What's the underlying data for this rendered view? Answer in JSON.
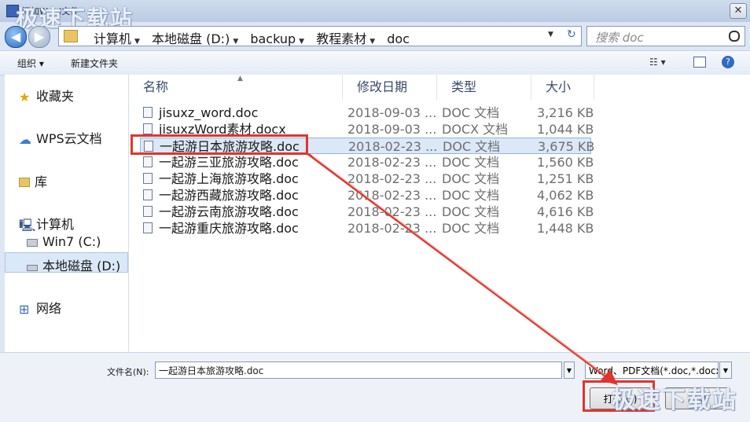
{
  "window": {
    "title": "添加Word文件",
    "close_glyph": "✕",
    "watermark": "极速下载站"
  },
  "address": {
    "crumbs": [
      "计算机",
      "本地磁盘 (D:)",
      "backup",
      "教程素材",
      "doc"
    ],
    "search_placeholder": "搜索 doc"
  },
  "toolbar": {
    "organize": "组织 ▾",
    "new_folder": "新建文件夹",
    "help": "?"
  },
  "sidebar": {
    "items": [
      {
        "label": "收藏夹",
        "icon": "star-icon"
      },
      {
        "label": "WPS云文档",
        "icon": "cloud-icon"
      },
      {
        "label": "库",
        "icon": "library-icon"
      },
      {
        "label": "计算机",
        "icon": "computer-icon"
      },
      {
        "label": "Win7 (C:)",
        "icon": "drive-icon"
      },
      {
        "label": "本地磁盘 (D:)",
        "icon": "drive-icon"
      },
      {
        "label": "网络",
        "icon": "network-icon"
      }
    ]
  },
  "columns": {
    "name": "名称",
    "date": "修改日期",
    "type": "类型",
    "size": "大小"
  },
  "files": [
    {
      "name": "jisuxz_word.doc",
      "date": "2018-09-03 ...",
      "type": "DOC 文档",
      "size": "3,216 KB"
    },
    {
      "name": "jisuxzWord素材.docx",
      "date": "2018-09-03 ...",
      "type": "DOCX 文档",
      "size": "1,044 KB"
    },
    {
      "name": "一起游日本旅游攻略.doc",
      "date": "2018-02-23 ...",
      "type": "DOC 文档",
      "size": "3,675 KB"
    },
    {
      "name": "一起游三亚旅游攻略.doc",
      "date": "2018-02-23 ...",
      "type": "DOC 文档",
      "size": "1,560 KB"
    },
    {
      "name": "一起游上海旅游攻略.doc",
      "date": "2018-02-23 ...",
      "type": "DOC 文档",
      "size": "1,251 KB"
    },
    {
      "name": "一起游西藏旅游攻略.doc",
      "date": "2018-02-23 ...",
      "type": "DOC 文档",
      "size": "4,062 KB"
    },
    {
      "name": "一起游云南旅游攻略.doc",
      "date": "2018-02-23 ...",
      "type": "DOC 文档",
      "size": "4,616 KB"
    },
    {
      "name": "一起游重庆旅游攻略.doc",
      "date": "2018-02-23 ...",
      "type": "DOC 文档",
      "size": "1,448 KB"
    }
  ],
  "bottom": {
    "filename_label": "文件名(N):",
    "filename_value": "一起游日本旅游攻略.doc",
    "filetype_value": "Word、PDF文档(*.doc,*.docx",
    "open_label": "打开(O)",
    "cancel_label": "取消"
  },
  "colors": {
    "highlight": "#e0352b",
    "accent": "#2b6cc4"
  }
}
